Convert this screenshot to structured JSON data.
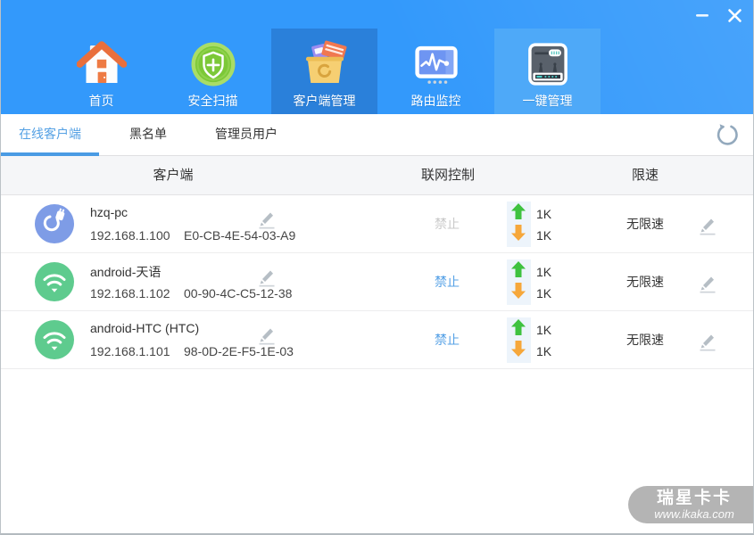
{
  "colors": {
    "header_blue": "#3399fb",
    "nav_active_bg": "#2a80da",
    "nav_highlight_bg": "#4ea9f8",
    "tab_active_blue": "#55a1e4",
    "link_blue": "#54a0e6",
    "disabled_gray": "#c9c9c9",
    "up_arrow_green": "#3fc23f",
    "down_arrow_orange": "#f6a73a",
    "wired_avatar_blue": "#7e9ce6",
    "wifi_avatar_green": "#5ecb8e",
    "watermark_gray": "#b4b4b4"
  },
  "nav": {
    "items": [
      {
        "id": "home",
        "label": "首页",
        "state": "normal"
      },
      {
        "id": "scan",
        "label": "安全扫描",
        "state": "normal"
      },
      {
        "id": "clients",
        "label": "客户端管理",
        "state": "active"
      },
      {
        "id": "monitor",
        "label": "路由监控",
        "state": "normal"
      },
      {
        "id": "onekey",
        "label": "一键管理",
        "state": "highlight"
      }
    ]
  },
  "tabs": {
    "items": [
      {
        "label": "在线客户端",
        "active": true
      },
      {
        "label": "黑名单",
        "active": false
      },
      {
        "label": "管理员用户",
        "active": false
      }
    ]
  },
  "table": {
    "columns": {
      "client": "客户端",
      "control": "联网控制",
      "limit": "限速"
    },
    "rows": [
      {
        "type": "wired",
        "name": "hzq-pc",
        "ip": "192.168.1.100",
        "mac": "E0-CB-4E-54-03-A9",
        "control": "禁止",
        "control_enabled": false,
        "up": "1K",
        "down": "1K",
        "limit": "无限速"
      },
      {
        "type": "wifi",
        "name": "android-天语",
        "ip": "192.168.1.102",
        "mac": "00-90-4C-C5-12-38",
        "control": "禁止",
        "control_enabled": true,
        "up": "1K",
        "down": "1K",
        "limit": "无限速"
      },
      {
        "type": "wifi",
        "name": "android-HTC (HTC)",
        "ip": "192.168.1.101",
        "mac": "98-0D-2E-F5-1E-03",
        "control": "禁止",
        "control_enabled": true,
        "up": "1K",
        "down": "1K",
        "limit": "无限速"
      }
    ]
  },
  "watermark": {
    "brand": "瑞星卡卡",
    "site": "www.ikaka.com"
  }
}
